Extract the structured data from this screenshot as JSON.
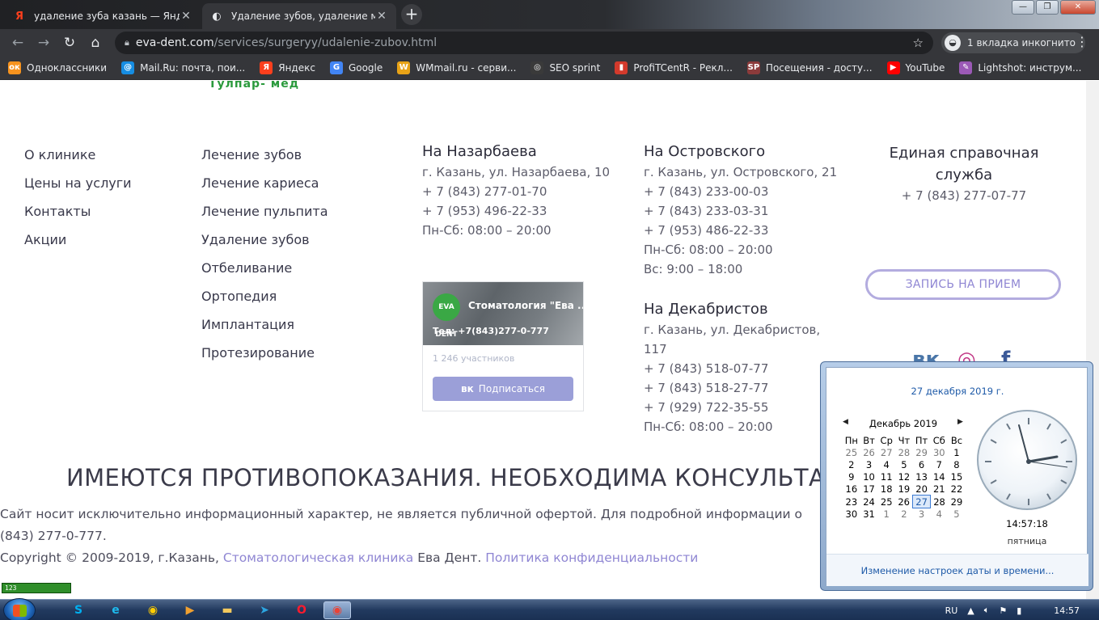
{
  "browser": {
    "tabs": [
      {
        "title": "удаление зуба казань — Яндекс",
        "favicon": "Я",
        "favicon_color": "#fc3f1d"
      },
      {
        "title": "Удаление зубов, удаление моло",
        "favicon": "◐",
        "favicon_color": "#e8eaed"
      }
    ],
    "new_tab": "+",
    "url_host": "eva-dent.com",
    "url_path": "/services/surgeryy/udalenie-zubov.html",
    "incognito_label": "1 вкладка инкогнито",
    "bookmarks": [
      {
        "label": "Одноклассники",
        "icon": "ok-icon",
        "glyph": "ок",
        "color": "#f7931e"
      },
      {
        "label": "Mail.Ru: почта, пои...",
        "icon": "mailru-icon",
        "glyph": "@",
        "color": "#168de2"
      },
      {
        "label": "Яндекс",
        "icon": "yandex-icon",
        "glyph": "Я",
        "color": "#fc3f1d"
      },
      {
        "label": "Google",
        "icon": "google-icon",
        "glyph": "G",
        "color": "#4285f4"
      },
      {
        "label": "WMmail.ru - серви...",
        "icon": "wmmail-icon",
        "glyph": "W",
        "color": "#e8a317"
      },
      {
        "label": "SEO sprint",
        "icon": "seosprint-icon",
        "glyph": "◎",
        "color": "#3a3a3a"
      },
      {
        "label": "ProfiTCentR - Рекл...",
        "icon": "profitcentr-icon",
        "glyph": "▮",
        "color": "#d33a2c"
      },
      {
        "label": "Посещения - досту...",
        "icon": "sp-icon",
        "glyph": "SP",
        "color": "#8c3b3b"
      },
      {
        "label": "YouTube",
        "icon": "youtube-icon",
        "glyph": "▶",
        "color": "#ff0000"
      },
      {
        "label": "Lightshot: инструм...",
        "icon": "lightshot-icon",
        "glyph": "✎",
        "color": "#9b59b6"
      }
    ]
  },
  "site": {
    "logo_tail": "Тулпар- мед",
    "menu_left": [
      "О клинике",
      "Цены на услуги",
      "Контакты",
      "Акции"
    ],
    "menu_services": [
      "Лечение зубов",
      "Лечение кариеса",
      "Лечение пульпита",
      "Удаление зубов",
      "Отбеливание",
      "Ортопедия",
      "Имплантация",
      "Протезирование"
    ],
    "office_nazarbaeva": {
      "title": "На Назарбаева",
      "lines": [
        "г. Казань, ул. Назарбаева, 10",
        "+ 7 (843) 277-01-70",
        "+ 7 (953) 496-22-33",
        "Пн-Сб: 08:00 – 20:00"
      ]
    },
    "office_ostrovskogo": {
      "title": "На Островского",
      "lines": [
        "г. Казань, ул. Островского, 21",
        "+ 7 (843) 233-00-03",
        "+ 7 (843) 233-03-31",
        "+ 7 (953) 486-22-33",
        "Пн-Сб: 08:00 – 20:00",
        "Вс: 9:00 – 18:00"
      ]
    },
    "office_dekabristov": {
      "title": "На Декабристов",
      "lines": [
        "г. Казань, ул. Декабристов,",
        "117",
        "+ 7 (843) 518-07-77",
        "+ 7 (843) 518-27-77",
        "+ 7 (929) 722-35-55",
        "Пн-Сб: 08:00 – 20:00"
      ]
    },
    "help_title": "Единая справочная служба",
    "help_phone": "+ 7 (843) 277-07-77",
    "appointment_button": "ЗАПИСЬ НА ПРИЕМ",
    "social": [
      {
        "icon": "vk-icon",
        "glyph": "вк",
        "color": "#4a76a8"
      },
      {
        "icon": "instagram-icon",
        "glyph": "◎",
        "color": "#c13584"
      },
      {
        "icon": "facebook-icon",
        "glyph": "f",
        "color": "#3b5998"
      }
    ],
    "vk_widget": {
      "group_name": "Стоматология \"Ева ...",
      "phone": "Тел: +7(843)277-0-777",
      "members": "1 246 участников",
      "subscribe": "Подписаться",
      "logo_text": "EVA DENT"
    },
    "warning": "ИМЕЮТСЯ ПРОТИВОПОКАЗАНИЯ. НЕОБХОДИМА КОНСУЛЬТАЦИ",
    "disclaimer_line1": "Сайт носит исключительно информационный характер, не является публичной офертой. Для подробной информации о",
    "disclaimer_line2": "(843) 277-0-777.",
    "copyright_prefix": "Copyright © 2009-2019, г.Казань, ",
    "copyright_link1": "Стоматологическая клиника",
    "copyright_mid": " Ева Дент. ",
    "copyright_link2": "Политика конфиденциальности",
    "kbd_indicator": "123"
  },
  "calendar": {
    "full_date": "27 декабря 2019 г.",
    "month_title": "Декабрь 2019",
    "weekdays": [
      "Пн",
      "Вт",
      "Ср",
      "Чт",
      "Пт",
      "Сб",
      "Вс"
    ],
    "weeks": [
      [
        "25",
        "26",
        "27",
        "28",
        "29",
        "30",
        "1"
      ],
      [
        "2",
        "3",
        "4",
        "5",
        "6",
        "7",
        "8"
      ],
      [
        "9",
        "10",
        "11",
        "12",
        "13",
        "14",
        "15"
      ],
      [
        "16",
        "17",
        "18",
        "19",
        "20",
        "21",
        "22"
      ],
      [
        "23",
        "24",
        "25",
        "26",
        "27",
        "28",
        "29"
      ],
      [
        "30",
        "31",
        "1",
        "2",
        "3",
        "4",
        "5"
      ]
    ],
    "today": "27",
    "time": "14:57:18",
    "weekday_name": "пятница",
    "change_settings": "Изменение настроек даты и времени..."
  },
  "taskbar": {
    "language": "RU",
    "clock": "14:57",
    "apps": [
      {
        "icon": "skype-icon",
        "glyph": "S",
        "color": "#00aff0"
      },
      {
        "icon": "ie-icon",
        "glyph": "e",
        "color": "#1ebbee"
      },
      {
        "icon": "yandex-browser-icon",
        "glyph": "◉",
        "color": "#ffcc00"
      },
      {
        "icon": "media-player-icon",
        "glyph": "▶",
        "color": "#f0a030"
      },
      {
        "icon": "explorer-icon",
        "glyph": "▬",
        "color": "#f4c95d"
      },
      {
        "icon": "telegram-icon",
        "glyph": "➤",
        "color": "#2ca5e0"
      },
      {
        "icon": "opera-icon",
        "glyph": "O",
        "color": "#ff1b2d"
      },
      {
        "icon": "chrome-icon",
        "glyph": "◉",
        "color": "#ea4335"
      }
    ]
  }
}
